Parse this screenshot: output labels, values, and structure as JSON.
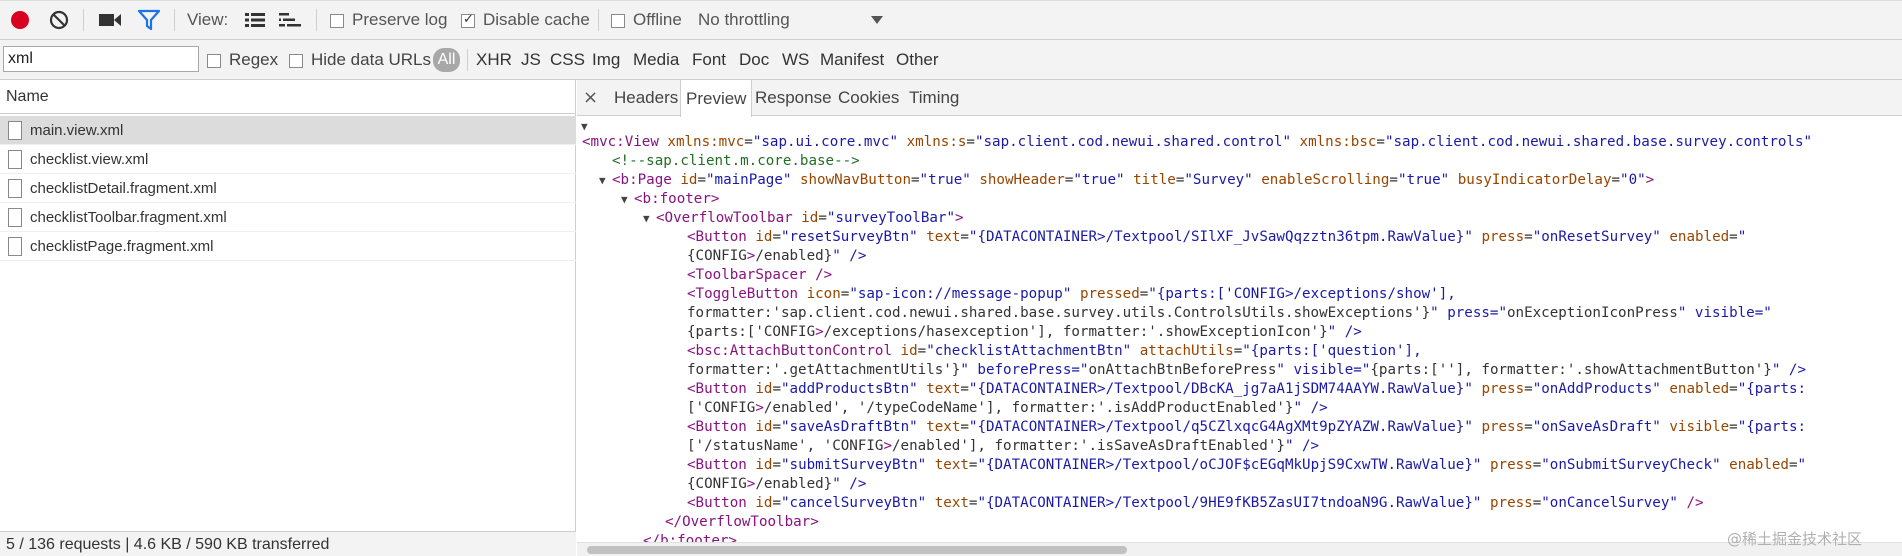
{
  "toolbar": {
    "record_icon": "record-icon",
    "clear_icon": "clear-icon",
    "capture_icon": "video-camera-icon",
    "filter_icon": "filter-icon",
    "view_label": "View:",
    "preserve_log": "Preserve log",
    "disable_cache": "Disable cache",
    "offline": "Offline",
    "throttling": "No throttling"
  },
  "filterbar": {
    "search_value": "xml",
    "regex": "Regex",
    "hide_data_urls": "Hide data URLs",
    "types": [
      "All",
      "XHR",
      "JS",
      "CSS",
      "Img",
      "Media",
      "Font",
      "Doc",
      "WS",
      "Manifest",
      "Other"
    ]
  },
  "requests": {
    "header": "Name",
    "files": [
      "main.view.xml",
      "checklist.view.xml",
      "checklistDetail.fragment.xml",
      "checklistToolbar.fragment.xml",
      "checklistPage.fragment.xml"
    ],
    "status": "5 / 136 requests  |  4.6 KB / 590 KB transferred"
  },
  "detail": {
    "close": "×",
    "tabs": [
      "Headers",
      "Preview",
      "Response",
      "Cookies",
      "Timing"
    ],
    "preview_lines": [
      "<mvc:View xmlns:mvc=\"sap.ui.core.mvc\" xmlns:s=\"sap.client.cod.newui.shared.control\" xmlns:bsc=\"sap.client.cod.newui.shared.base.survey.controls\"",
      "<!--sap.client.m.core.base-->",
      "<b:Page id=\"mainPage\" showNavButton=\"true\" showHeader=\"true\" title=\"Survey\" enableScrolling=\"true\" busyIndicatorDelay=\"0\">",
      "<b:footer>",
      "<OverflowToolbar id=\"surveyToolBar\">",
      "<Button id=\"resetSurveyBtn\" text=\"{DATACONTAINER>/Textpool/SIlXF_JvSawQqzztn36tpm.RawValue}\" press=\"onResetSurvey\" enabled=\"",
      "{CONFIG>/enabled}\" />",
      "<ToolbarSpacer />",
      "<ToggleButton icon=\"sap-icon://message-popup\" pressed=\"{parts:['CONFIG>/exceptions/show'],",
      "formatter:'sap.client.cod.newui.shared.base.survey.utils.ControlsUtils.showExceptions'}\" press=\"onExceptionIconPress\" visible=\"",
      "{parts:['CONFIG>/exceptions/hasexception'], formatter:'.showExceptionIcon'}\" />",
      "<bsc:AttachButtonControl id=\"checklistAttachmentBtn\" attachUtils=\"{parts:['question'],",
      "formatter:'.getAttachmentUtils'}\" beforePress=\"onAttachBtnBeforePress\" visible=\"{parts:[''], formatter:'.showAttachmentButton'}\" />",
      "<Button id=\"addProductsBtn\" text=\"{DATACONTAINER>/Textpool/DBcKA_jg7aA1jSDM74AAYW.RawValue}\" press=\"onAddProducts\" enabled=\"{parts:",
      "['CONFIG>/enabled', '/typeCodeName'], formatter:'.isAddProductEnabled'}\" />",
      "<Button id=\"saveAsDraftBtn\" text=\"{DATACONTAINER>/Textpool/q5CZlxqcG4AgXMt9pZYAZW.RawValue}\" press=\"onSaveAsDraft\" visible=\"{parts:",
      "['/statusName', 'CONFIG>/enabled'], formatter:'.isSaveAsDraftEnabled'}\" />",
      "<Button id=\"submitSurveyBtn\" text=\"{DATACONTAINER>/Textpool/oCJOF$cEGqMkUpjS9CxwTW.RawValue}\" press=\"onSubmitSurveyCheck\" enabled=\"",
      "{CONFIG>/enabled}\" />",
      "<Button id=\"cancelSurveyBtn\" text=\"{DATACONTAINER>/Textpool/9HE9fKB5ZasUI7tndoaN9G.RawValue}\" press=\"onCancelSurvey\" />",
      "</OverflowToolbar>",
      "</b:footer>"
    ]
  },
  "watermark": "@稀土掘金技术社区",
  "colors": {
    "record": "#d8001e",
    "filter": "#1a73e8",
    "tag": "#881280",
    "attr": "#994500",
    "value": "#1a1aa6",
    "comment": "#236e25"
  }
}
